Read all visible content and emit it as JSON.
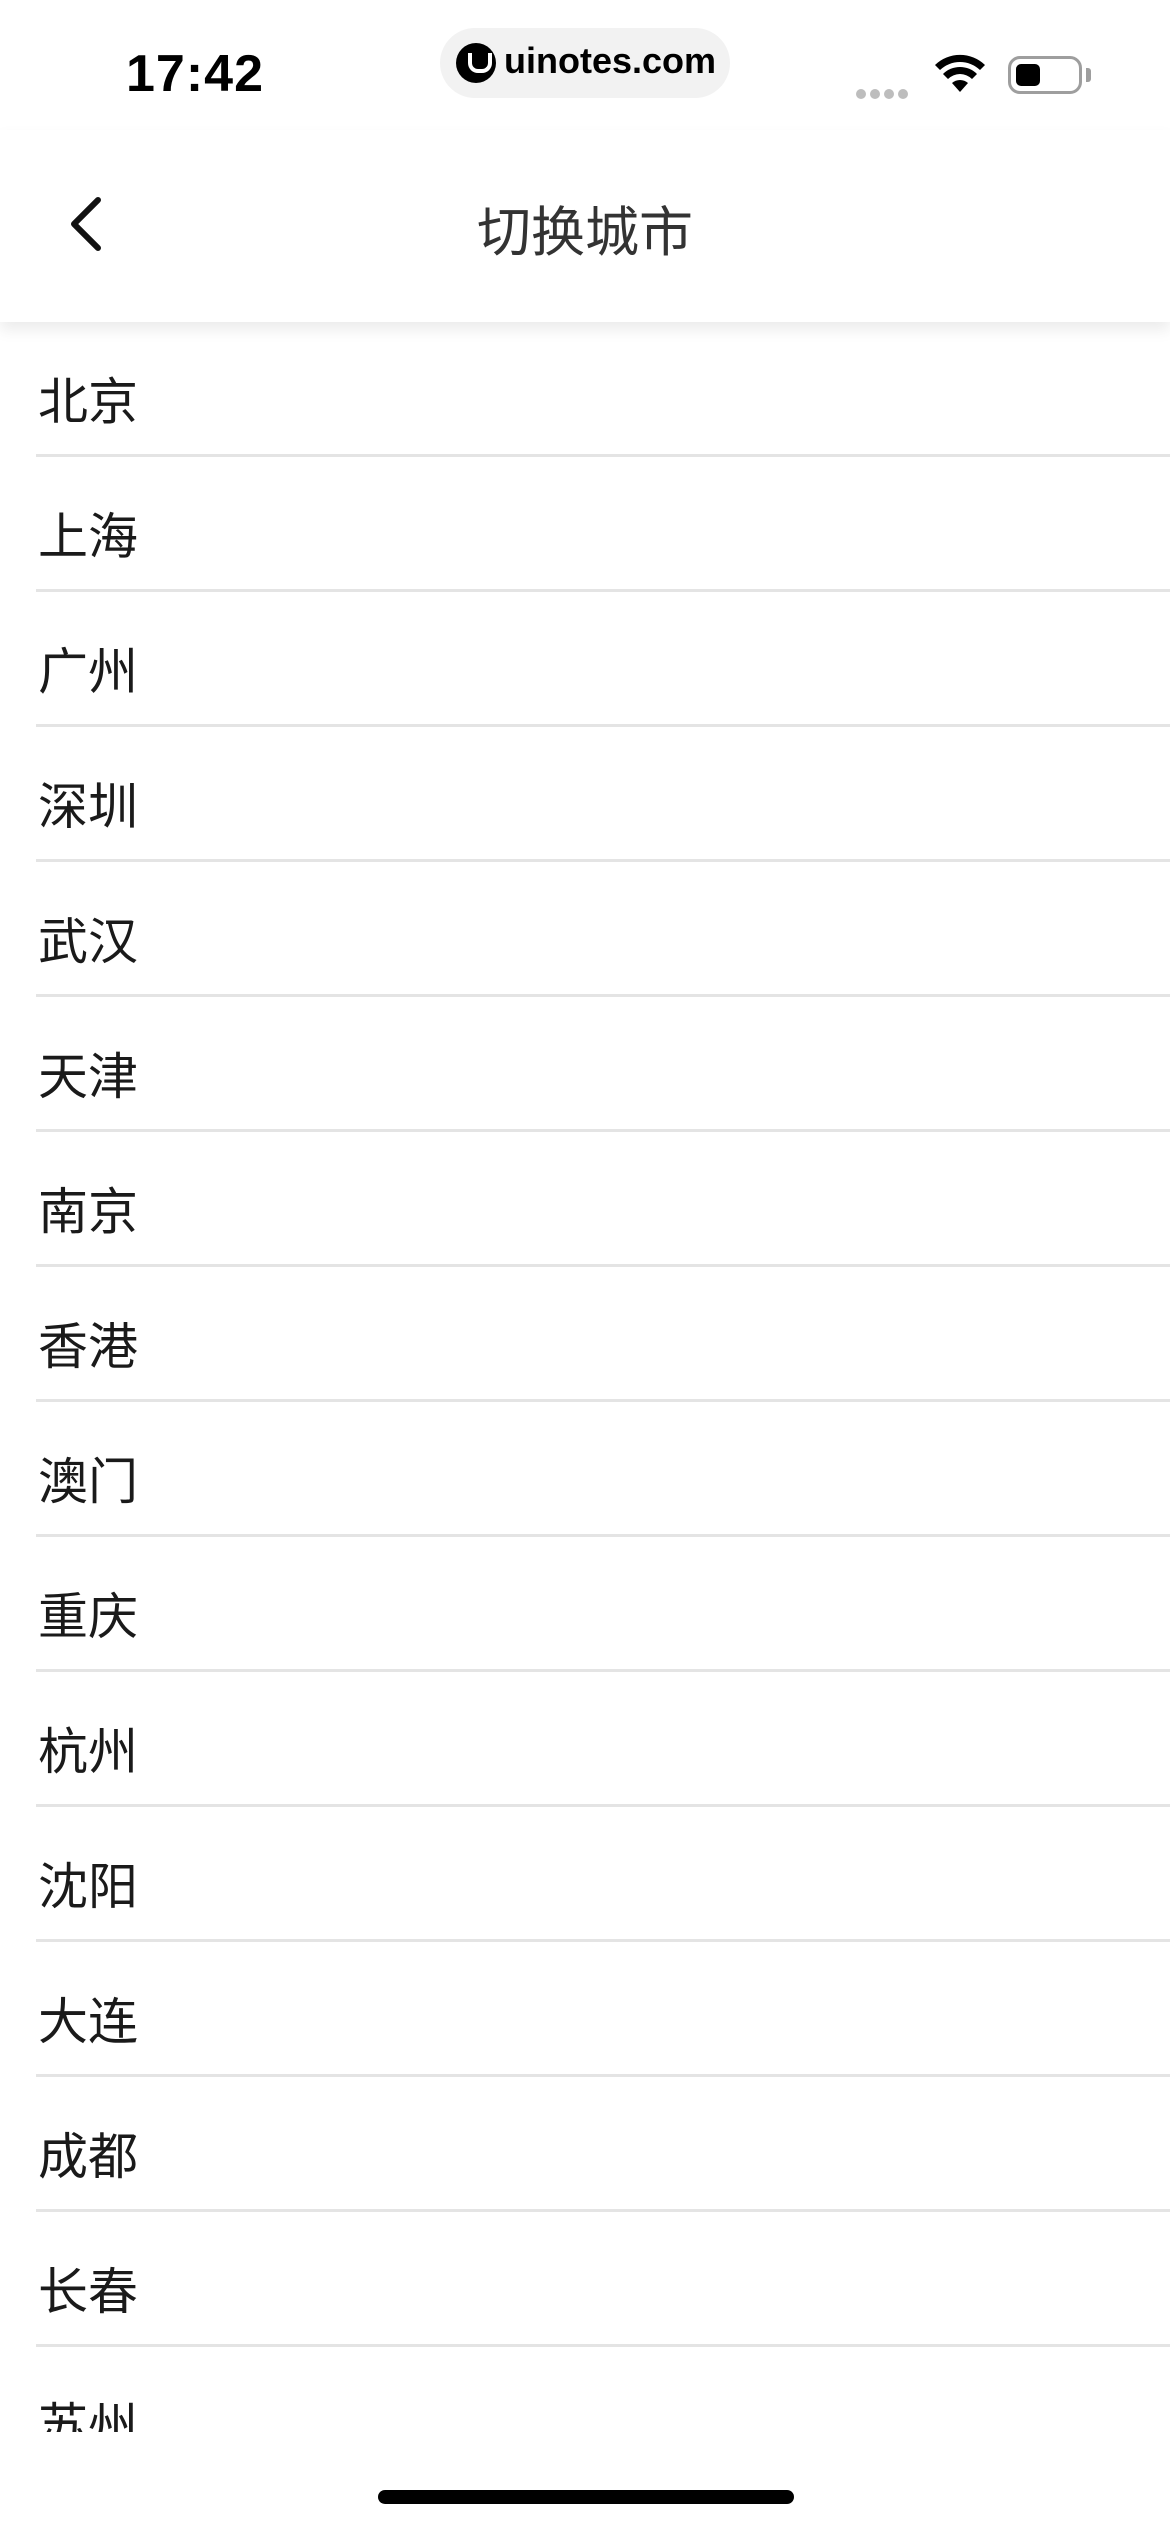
{
  "status_bar": {
    "time": "17:42",
    "url": "uinotes.com"
  },
  "header": {
    "title": "切换城市",
    "back_icon": "chevron-left-icon"
  },
  "cities": [
    "北京",
    "上海",
    "广州",
    "深圳",
    "武汉",
    "天津",
    "南京",
    "香港",
    "澳门",
    "重庆",
    "杭州",
    "沈阳",
    "大连",
    "成都",
    "长春",
    "苏州"
  ]
}
